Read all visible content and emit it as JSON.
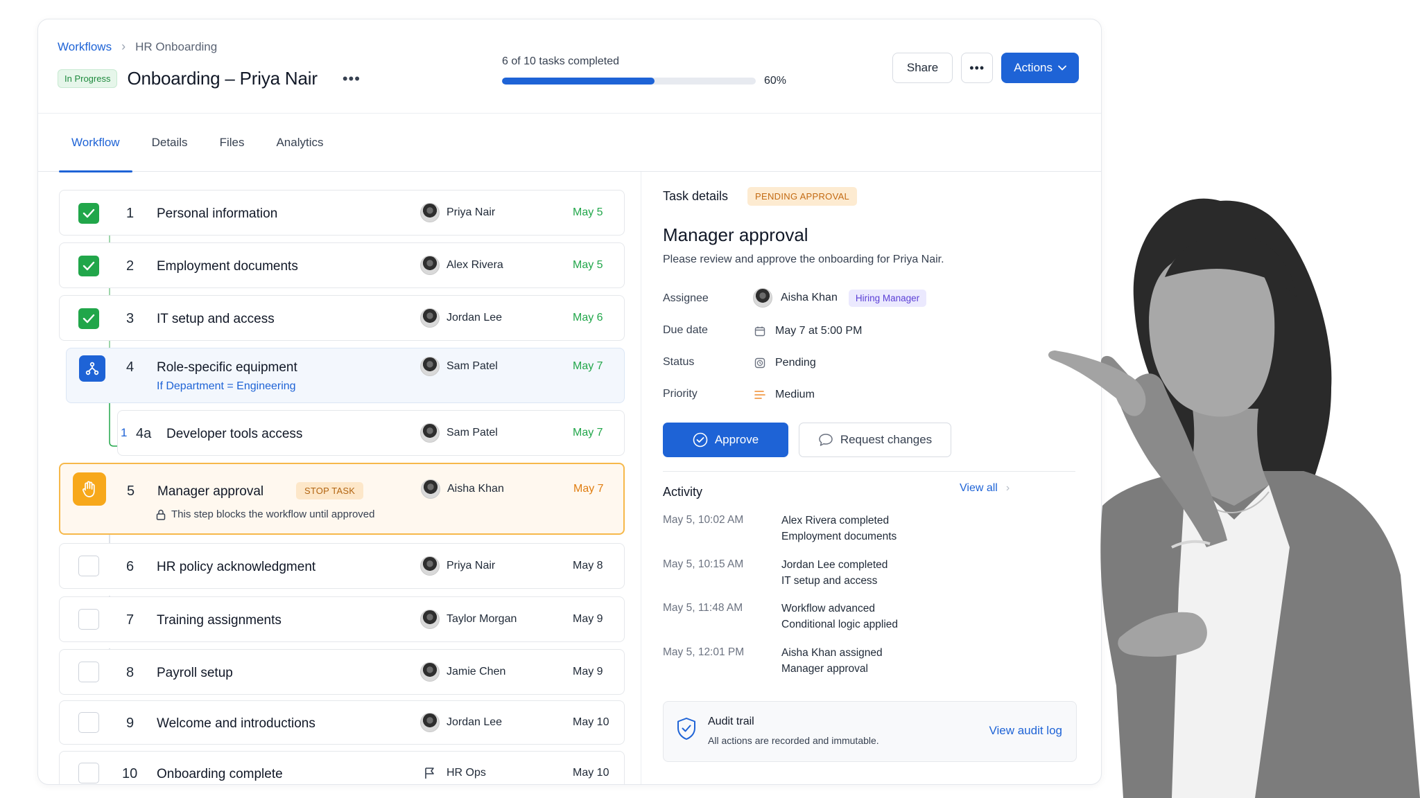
{
  "breadcrumb": {
    "root": "Workflows",
    "current": "HR Onboarding"
  },
  "header": {
    "status": "In Progress",
    "title": "Onboarding – Priya Nair",
    "more": "•••",
    "progress_text": "6 of 10 tasks completed",
    "progress_value": 0.6,
    "progress_pct": "60%",
    "share": "Share",
    "actions": "Actions"
  },
  "tabs": [
    "Workflow",
    "Details",
    "Files",
    "Analytics"
  ],
  "tasks": [
    {
      "num": "1",
      "name": "Personal information",
      "assignee": "Priya Nair",
      "date": "May 5",
      "state": "done"
    },
    {
      "num": "2",
      "name": "Employment documents",
      "assignee": "Alex Rivera",
      "date": "May 5",
      "state": "done"
    },
    {
      "num": "3",
      "name": "IT setup and access",
      "assignee": "Jordan Lee",
      "date": "May 6",
      "state": "done"
    },
    {
      "num": "4",
      "name": "Role-specific equipment",
      "condition": "If Department = Engineering",
      "assignee": "Sam Patel",
      "date": "May 7",
      "state": "conditional"
    },
    {
      "num": "4a",
      "name": "Developer tools access",
      "assignee": "Sam Patel",
      "date": "May 7",
      "state": "subtask",
      "marker": "1"
    },
    {
      "num": "5",
      "name": "Manager approval",
      "badge": "STOP TASK",
      "note": "This step blocks the workflow until approved",
      "assignee": "Aisha Khan",
      "date": "May 7",
      "state": "stop"
    },
    {
      "num": "6",
      "name": "HR policy acknowledgment",
      "assignee": "Priya Nair",
      "date": "May 8",
      "state": "todo"
    },
    {
      "num": "7",
      "name": "Training assignments",
      "assignee": "Taylor Morgan",
      "date": "May 9",
      "state": "todo"
    },
    {
      "num": "8",
      "name": "Payroll setup",
      "assignee": "Jamie Chen",
      "date": "May 9",
      "state": "todo"
    },
    {
      "num": "9",
      "name": "Welcome and introductions",
      "assignee": "Jordan Lee",
      "date": "May 10",
      "state": "todo"
    },
    {
      "num": "10",
      "name": "Onboarding complete",
      "assignee": "HR Ops",
      "date": "May 10",
      "state": "todo",
      "icon": "flag-icon"
    }
  ],
  "details": {
    "heading": "Task details",
    "badge": "PENDING APPROVAL",
    "title": "Manager approval",
    "description": "Please review and approve the onboarding for Priya Nair.",
    "assignee_label": "Assignee",
    "assignee": "Aisha Khan",
    "role": "Hiring Manager",
    "due_label": "Due date",
    "due": "May 7 at 5:00 PM",
    "status_label": "Status",
    "status": "Pending",
    "priority_label": "Priority",
    "priority": "Medium",
    "approve": "Approve",
    "request_changes": "Request changes"
  },
  "activity": {
    "title": "Activity",
    "view_all": "View all",
    "items": [
      {
        "time": "May 5, 10:02 AM",
        "line1": "Alex Rivera completed",
        "line2": "Employment documents"
      },
      {
        "time": "May 5, 10:15 AM",
        "line1": "Jordan Lee completed",
        "line2": "IT setup and access"
      },
      {
        "time": "May 5, 11:48 AM",
        "line1": "Workflow advanced",
        "line2": "Conditional logic applied"
      },
      {
        "time": "May 5, 12:01 PM",
        "line1": "Aisha Khan assigned",
        "line2": "Manager approval"
      }
    ]
  },
  "audit": {
    "title": "Audit trail",
    "subtitle": "All actions are recorded and immutable.",
    "link": "View audit log"
  },
  "colors": {
    "accent": "#1e63d6",
    "done": "#21a64a",
    "stop": "#f7a81b",
    "pending": "#c36a12"
  }
}
